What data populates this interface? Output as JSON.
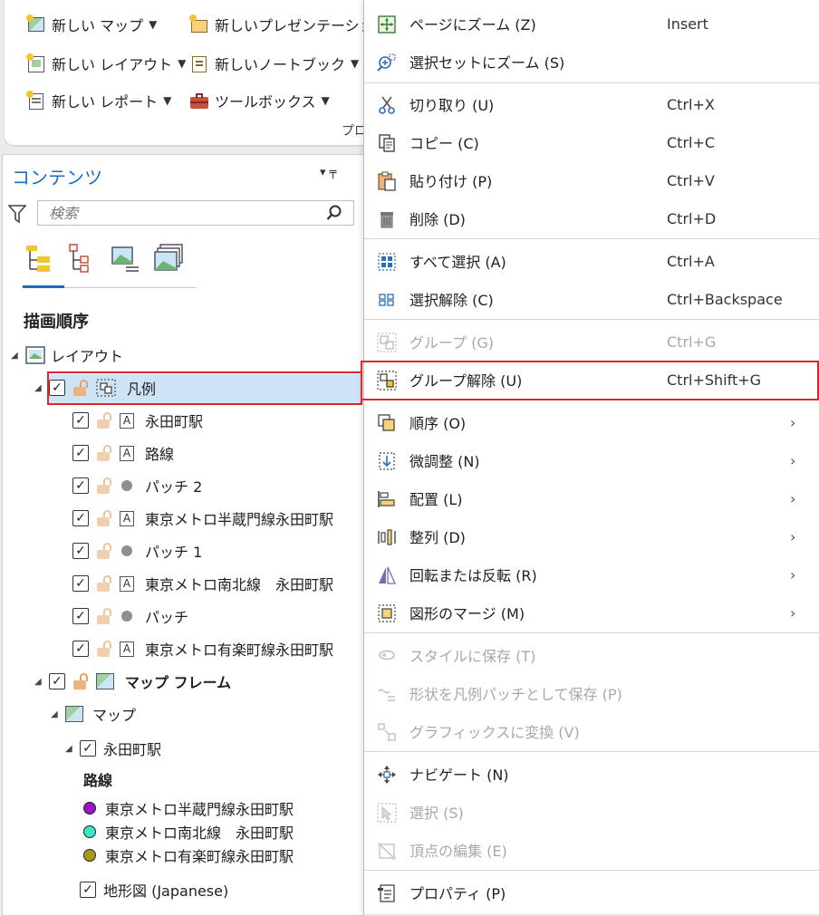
{
  "ribbon": {
    "new_map": "新しい マップ",
    "new_presentation": "新しいプレゼンテーション",
    "new_layout": "新しい レイアウト",
    "new_notebook": "新しいノートブック",
    "new_report": "新しい レポート",
    "toolbox": "ツールボックス",
    "group_label": "プロ"
  },
  "contents": {
    "title": "コンテンツ",
    "pin_glyph": "▾  ╤",
    "search_placeholder": "検索",
    "draw_order": "描画順序",
    "tree": {
      "layout": "レイアウト",
      "legend": "凡例",
      "legend_items": [
        {
          "label": "永田町駅",
          "type": "text"
        },
        {
          "label": "路線",
          "type": "text"
        },
        {
          "label": "パッチ 2",
          "type": "patch"
        },
        {
          "label": "東京メトロ半蔵門線永田町駅",
          "type": "text"
        },
        {
          "label": "パッチ 1",
          "type": "patch"
        },
        {
          "label": "東京メトロ南北線　永田町駅",
          "type": "text"
        },
        {
          "label": "パッチ",
          "type": "patch"
        },
        {
          "label": "東京メトロ有楽町線永田町駅",
          "type": "text"
        }
      ],
      "map_frame": "マップ フレーム",
      "map": "マップ",
      "station_layer": "永田町駅",
      "route_heading": "路線",
      "routes": [
        {
          "label": "東京メトロ半蔵門線永田町駅",
          "color": "#9b14c8"
        },
        {
          "label": "東京メトロ南北線　永田町駅",
          "color": "#38e6c8"
        },
        {
          "label": "東京メトロ有楽町線永田町駅",
          "color": "#a89a14"
        }
      ],
      "basemap": "地形図 (Japanese)"
    }
  },
  "menu": {
    "zoom_page": {
      "label": "ページにズーム (Z)",
      "shortcut": "Insert"
    },
    "zoom_selection": {
      "label": "選択セットにズーム (S)",
      "shortcut": ""
    },
    "cut": {
      "label": "切り取り (U)",
      "shortcut": "Ctrl+X"
    },
    "copy": {
      "label": "コピー (C)",
      "shortcut": "Ctrl+C"
    },
    "paste": {
      "label": "貼り付け (P)",
      "shortcut": "Ctrl+V"
    },
    "delete": {
      "label": "削除 (D)",
      "shortcut": "Ctrl+D"
    },
    "select_all": {
      "label": "すべて選択 (A)",
      "shortcut": "Ctrl+A"
    },
    "clear_selection": {
      "label": "選択解除 (C)",
      "shortcut": "Ctrl+Backspace"
    },
    "group": {
      "label": "グループ (G)",
      "shortcut": "Ctrl+G"
    },
    "ungroup": {
      "label": "グループ解除 (U)",
      "shortcut": "Ctrl+Shift+G"
    },
    "order": {
      "label": "順序 (O)"
    },
    "nudge": {
      "label": "微調整 (N)"
    },
    "align": {
      "label": "配置 (L)"
    },
    "distribute": {
      "label": "整列 (D)"
    },
    "rotate_flip": {
      "label": "回転または反転 (R)"
    },
    "shape_merge": {
      "label": "図形のマージ (M)"
    },
    "save_style": {
      "label": "スタイルに保存 (T)"
    },
    "save_patch": {
      "label": "形状を凡例パッチとして保存 (P)"
    },
    "convert_graphics": {
      "label": "グラフィックスに変換 (V)"
    },
    "navigate": {
      "label": "ナビゲート (N)"
    },
    "select": {
      "label": "選択 (S)"
    },
    "edit_vertices": {
      "label": "頂点の編集 (E)"
    },
    "properties": {
      "label": "プロパティ (P)"
    },
    "submenu_glyph": "›"
  },
  "colors": {
    "accent": "#1a6cc3",
    "highlight_box": "#e0252b",
    "selected_row": "#cfe3f6"
  }
}
